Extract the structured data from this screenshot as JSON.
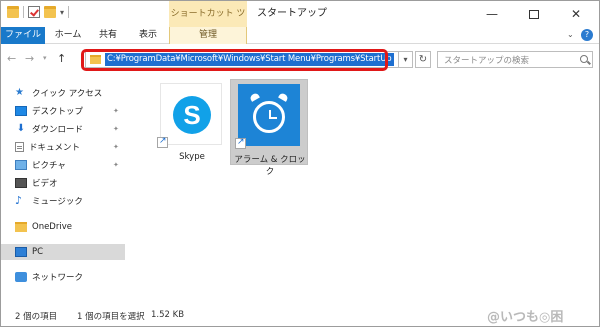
{
  "window": {
    "title": "スタートアップ",
    "context_tab_group": "ショートカット ツール"
  },
  "ribbon": {
    "tabs": [
      {
        "label": "ファイル"
      },
      {
        "label": "ホーム"
      },
      {
        "label": "共有"
      },
      {
        "label": "表示"
      },
      {
        "label": "管理"
      }
    ]
  },
  "address": {
    "path": "C:¥ProgramData¥Microsoft¥Windows¥Start Menu¥Programs¥StartUp",
    "highlight_color": "#e01818"
  },
  "search": {
    "placeholder": "スタートアップの検索"
  },
  "sidebar": {
    "items": [
      {
        "label": "クイック アクセス",
        "icon": "star-icon"
      },
      {
        "label": "デスクトップ",
        "icon": "desktop-icon",
        "pinned": true
      },
      {
        "label": "ダウンロード",
        "icon": "download-icon",
        "pinned": true
      },
      {
        "label": "ドキュメント",
        "icon": "document-icon",
        "pinned": true
      },
      {
        "label": "ピクチャ",
        "icon": "pictures-icon",
        "pinned": true
      },
      {
        "label": "ビデオ",
        "icon": "video-icon"
      },
      {
        "label": "ミュージック",
        "icon": "music-icon"
      },
      {
        "label": "OneDrive",
        "icon": "onedrive-icon"
      },
      {
        "label": "PC",
        "icon": "pc-icon",
        "selected": true
      },
      {
        "label": "ネットワーク",
        "icon": "network-icon"
      }
    ]
  },
  "files": [
    {
      "label": "Skype",
      "icon": "skype-icon",
      "shortcut": true,
      "selected": false
    },
    {
      "label": "アラーム & クロック",
      "icon": "alarm-clock-icon",
      "shortcut": true,
      "selected": true
    }
  ],
  "status": {
    "item_count": "2 個の項目",
    "selection": "1 個の項目を選択",
    "size": "1.52 KB"
  },
  "watermark": "@いつも◎困"
}
